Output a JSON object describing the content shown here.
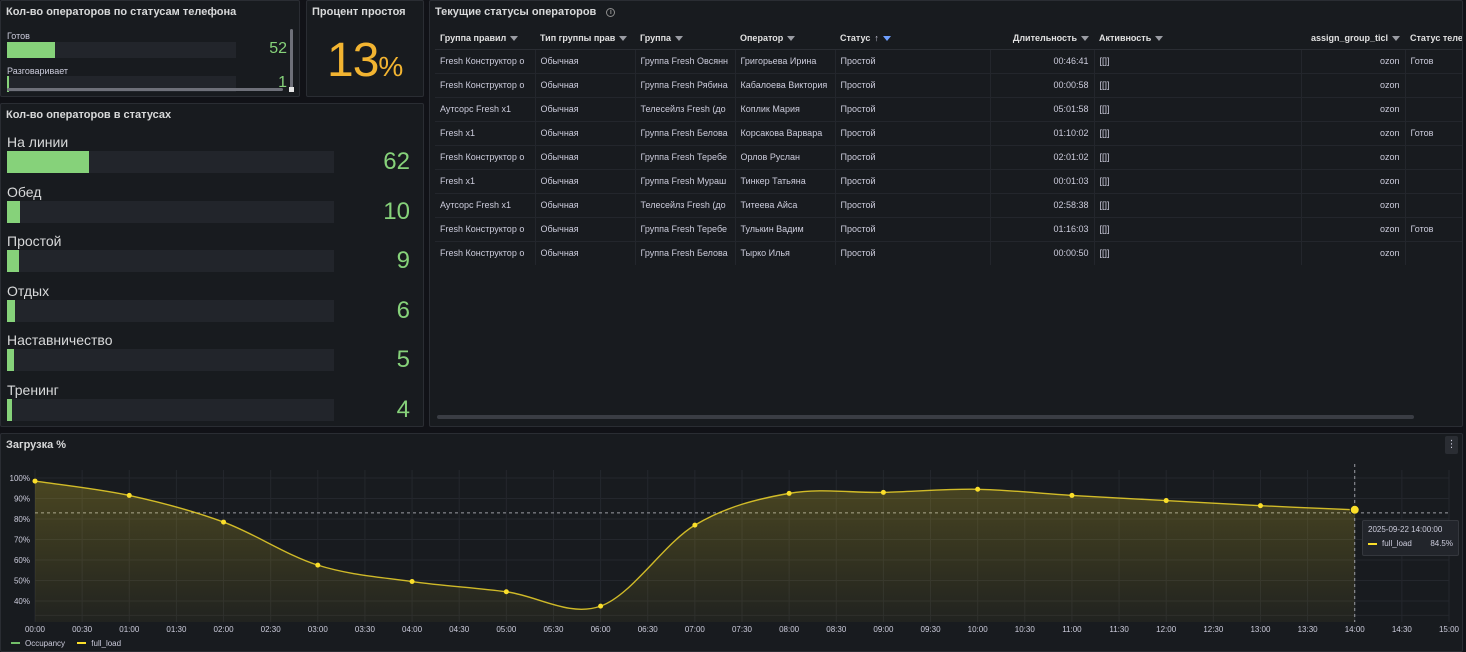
{
  "phone_panel": {
    "title": "Кол-во операторов по статусам телефона",
    "rows": [
      {
        "label": "Готов",
        "value": "52",
        "fill": 0.21
      },
      {
        "label": "Разговаривает",
        "value": "1",
        "fill": 0.01
      }
    ]
  },
  "idle_panel": {
    "title": "Процент простоя",
    "value": "13",
    "unit": "%"
  },
  "statuses_panel": {
    "title": "Кол-во операторов в статусах",
    "rows": [
      {
        "label": "На линии",
        "value": "62",
        "fill": 0.25
      },
      {
        "label": "Обед",
        "value": "10",
        "fill": 0.04
      },
      {
        "label": "Простой",
        "value": "9",
        "fill": 0.036
      },
      {
        "label": "Отдых",
        "value": "6",
        "fill": 0.024
      },
      {
        "label": "Наставничество",
        "value": "5",
        "fill": 0.02
      },
      {
        "label": "Тренинг",
        "value": "4",
        "fill": 0.016
      }
    ]
  },
  "table_panel": {
    "title": "Текущие статусы операторов",
    "columns": [
      "Группа правил",
      "Тип группы прав",
      "Группа",
      "Оператор",
      "Статус",
      "Длительность",
      "Активность",
      "assign_group_ticl",
      "Статус теле"
    ],
    "sorted_column": "Статус",
    "rows": [
      [
        "Fresh Конструктор о",
        "Обычная",
        "Группа Fresh Овсянн",
        "Григорьева Ирина",
        "Простой",
        "00:46:41",
        "[[]]",
        "ozon",
        "Готов"
      ],
      [
        "Fresh Конструктор о",
        "Обычная",
        "Группа Fresh Рябина",
        "Кабалоева Виктория",
        "Простой",
        "00:00:58",
        "[[]]",
        "ozon",
        ""
      ],
      [
        "Аутсорс Fresh x1",
        "Обычная",
        "Телесейлз Fresh (до",
        "Коплик Мария",
        "Простой",
        "05:01:58",
        "[[]]",
        "ozon",
        ""
      ],
      [
        "Fresh x1",
        "Обычная",
        "Группа Fresh Белова",
        "Корсакова Варвара",
        "Простой",
        "01:10:02",
        "[[]]",
        "ozon",
        "Готов"
      ],
      [
        "Fresh Конструктор о",
        "Обычная",
        "Группа Fresh Теребе",
        "Орлов Руслан",
        "Простой",
        "02:01:02",
        "[[]]",
        "ozon",
        ""
      ],
      [
        "Fresh x1",
        "Обычная",
        "Группа Fresh Мураш",
        "Тинкер Татьяна",
        "Простой",
        "00:01:03",
        "[[]]",
        "ozon",
        ""
      ],
      [
        "Аутсорс Fresh x1",
        "Обычная",
        "Телесейлз Fresh (до",
        "Титеева Айса",
        "Простой",
        "02:58:38",
        "[[]]",
        "ozon",
        ""
      ],
      [
        "Fresh Конструктор о",
        "Обычная",
        "Группа Fresh Теребе",
        "Тулькин Вадим",
        "Простой",
        "01:16:03",
        "[[]]",
        "ozon",
        "Готов"
      ],
      [
        "Fresh Конструктор о",
        "Обычная",
        "Группа Fresh Белова",
        "Тырко Илья",
        "Простой",
        "00:00:50",
        "[[]]",
        "ozon",
        ""
      ]
    ]
  },
  "chart_panel": {
    "title": "Загрузка %",
    "menu_icon": "⋮",
    "tooltip": {
      "time": "2025-09-22 14:00:00",
      "series": "full_load",
      "value": "84.5%"
    },
    "legend": [
      {
        "name": "Occupancy",
        "color": "#73bf69"
      },
      {
        "name": "full_load",
        "color": "#fade2a"
      }
    ]
  },
  "chart_data": {
    "type": "line",
    "title": "Загрузка %",
    "xlabel": "",
    "ylabel": "",
    "x_ticks": [
      "00:00",
      "00:30",
      "01:00",
      "01:30",
      "02:00",
      "02:30",
      "03:00",
      "03:30",
      "04:00",
      "04:30",
      "05:00",
      "05:30",
      "06:00",
      "06:30",
      "07:00",
      "07:30",
      "08:00",
      "08:30",
      "09:00",
      "09:30",
      "10:00",
      "10:30",
      "11:00",
      "11:30",
      "12:00",
      "12:30",
      "13:00",
      "13:30",
      "14:00",
      "14:30",
      "15:00"
    ],
    "y_ticks": [
      "40%",
      "50%",
      "60%",
      "70%",
      "80%",
      "90%",
      "100%"
    ],
    "xlim": [
      0,
      15
    ],
    "ylim": [
      30,
      105
    ],
    "grid": true,
    "legend_position": "bottom-left",
    "threshold": 83,
    "series": [
      {
        "name": "full_load",
        "color": "#fade2a",
        "x": [
          0,
          1,
          2,
          3,
          4,
          5,
          6,
          7,
          8,
          9,
          10,
          11,
          12,
          13,
          14
        ],
        "values": [
          98.5,
          91.5,
          78.5,
          57.5,
          49.5,
          44.5,
          37.5,
          77,
          92.5,
          93,
          94.5,
          91.5,
          89,
          86.5,
          84.5
        ]
      },
      {
        "name": "Occupancy",
        "color": "#73bf69",
        "x": [],
        "values": []
      }
    ]
  }
}
